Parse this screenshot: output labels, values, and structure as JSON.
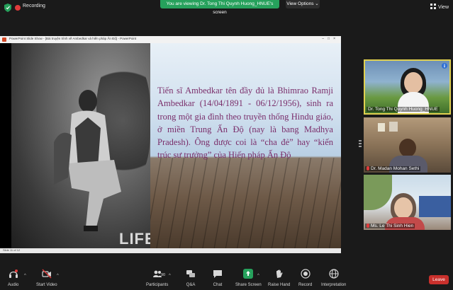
{
  "topbar": {
    "recording_label": "Recording",
    "viewing_label": "You are viewing Dr. Tong Thi Quynh Huong_HNUE's screen",
    "view_options_label": "View Options",
    "view_label": "View"
  },
  "share": {
    "ppt_title": "PowerPoint Slide Show - [Bài truyện trình về Ambedkar và hiến pháp Ấn Độ] - PowerPoint",
    "photo_watermark": "LIFE",
    "slide_text": "Tiến sĩ Ambedkar tên đầy đủ là Bhimrao Ramji Ambedkar (14/04/1891 - 06/12/1956), sinh ra trong một gia đình theo truyền thống Hindu giáo, ở miền Trung Ấn Độ (nay là bang Madhya Pradesh). Ông được coi là “cha đẻ” hay “kiến trúc sư trưởng” của Hiến pháp Ấn Độ",
    "slide_status": "Slide 11 of 12"
  },
  "participants": [
    {
      "name": "Dr. Tong Thi Quynh Huong_HNUE",
      "active": true
    },
    {
      "name": "Dr. Madan Mohan Sethi",
      "active": false
    },
    {
      "name": "Ms. Le Thi Sinh Hien",
      "active": false
    }
  ],
  "toolbar": {
    "audio": "Audio",
    "start_video": "Start Video",
    "participants": "Participants",
    "participants_count": "90",
    "qa": "Q&A",
    "chat": "Chat",
    "share_screen": "Share Screen",
    "raise_hand": "Raise Hand",
    "record": "Record",
    "interpretation": "Interpretation",
    "leave": "Leave"
  },
  "colors": {
    "accent_green": "#26a15c",
    "leave_red": "#c9302c",
    "active_speaker": "#e0d050",
    "slide_text": "#7a2d6a"
  }
}
